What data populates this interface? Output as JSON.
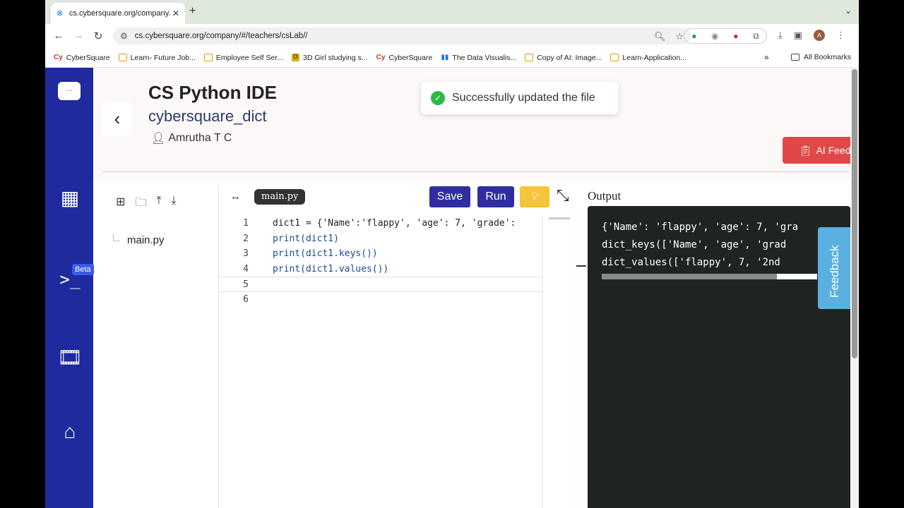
{
  "browser": {
    "tab_title": "cs.cybersquare.org/company/",
    "url": "cs.cybersquare.org/company/#/teachers/csLab//",
    "bookmarks": [
      {
        "label": "CyberSquare",
        "icon": "cy"
      },
      {
        "label": "Learn- Future Job...",
        "icon": "folder"
      },
      {
        "label": "Employee Self Ser...",
        "icon": "folder"
      },
      {
        "label": "3D Girl studying s...",
        "icon": "o"
      },
      {
        "label": "CyberSquare",
        "icon": "cy"
      },
      {
        "label": "The Data Visualis...",
        "icon": "bar"
      },
      {
        "label": "Copy of AI: Image...",
        "icon": "folder"
      },
      {
        "label": "Learn-Application...",
        "icon": "folder"
      }
    ],
    "all_bookmarks": "All Bookmarks",
    "avatar_letter": "A"
  },
  "header": {
    "app_title": "CS Python IDE",
    "file_title": "cybersquare_dict",
    "user_name": "Amrutha T C",
    "ai_feedback": "AI Feedback"
  },
  "toast": {
    "message": "Successfully updated the file"
  },
  "sidebar": {
    "beta_label": "Beta"
  },
  "files": {
    "items": [
      "main.py"
    ]
  },
  "editor": {
    "active_tab": "main.py",
    "save_label": "Save",
    "run_label": "Run",
    "line_numbers": [
      "1",
      "2",
      "3",
      "4",
      "5",
      "6"
    ],
    "lines": [
      "dict1 = {'Name':'flappy', 'age': 7, 'grade':",
      "print(dict1)",
      "print(dict1.keys())",
      "print(dict1.values())",
      "",
      ""
    ]
  },
  "output": {
    "label": "Output",
    "lines": [
      "{'Name': 'flappy', 'age': 7, 'gra",
      "dict_keys(['Name', 'age', 'grad",
      "dict_values(['flappy', 7, '2nd"
    ]
  },
  "feedback_tab": "Feedback",
  "colors": {
    "sidebar": "#1e2a9e",
    "primary_button": "#2f2e9f",
    "ai_button": "#e04848",
    "terminal_bg": "#1f2422",
    "feedback_tab": "#5ab0e0",
    "success": "#2db84a"
  }
}
